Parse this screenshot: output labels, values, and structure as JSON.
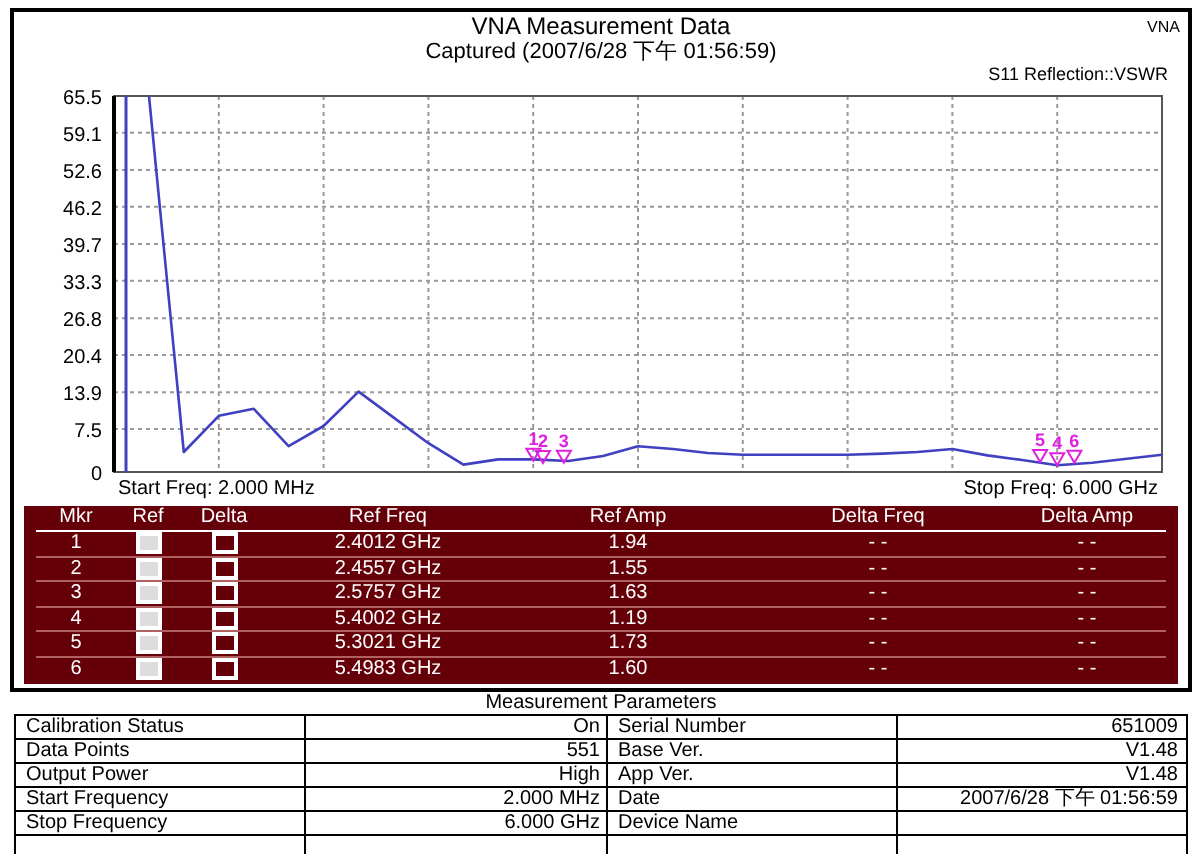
{
  "header": {
    "title": "VNA Measurement Data",
    "subtitle": "Captured  (2007/6/28 下午 01:56:59)",
    "badge": "VNA"
  },
  "chart": {
    "measurement": "S11 Reflection::VSWR",
    "start_label": "Start Freq: 2.000 MHz",
    "stop_label": "Stop Freq: 6.000 GHz",
    "chart_data": {
      "type": "line",
      "categories": [
        null,
        null,
        null,
        null,
        null,
        null,
        null,
        null,
        null,
        null,
        null,
        null,
        null,
        null,
        null,
        null,
        null,
        null,
        null,
        null,
        null,
        null,
        null,
        null,
        null,
        null,
        null,
        null,
        null,
        null,
        null
      ],
      "grid": true,
      "ylim": [
        0,
        65.5
      ],
      "yticks": [
        0,
        7.5,
        13.9,
        20.4,
        26.8,
        33.3,
        39.7,
        46.2,
        52.6,
        59.1,
        65.5
      ],
      "series": [
        {
          "color": "#4040c0",
          "values": [
            null,
            65.5,
            3.5,
            9.8,
            11,
            4.5,
            8,
            14,
            9.5,
            5,
            1.3,
            2.2,
            2.2,
            1.9,
            2.8,
            4.5,
            4,
            3.3,
            3,
            3,
            3,
            3,
            3.2,
            3.5,
            4,
            2.9,
            2.1,
            1.2,
            1.6,
            2.3,
            3
          ]
        }
      ]
    },
    "marker_labels": [
      "1",
      "2",
      "3",
      "5",
      "4",
      "6"
    ]
  },
  "markers": {
    "columns": [
      "Mkr",
      "Ref",
      "Delta",
      "Ref Freq",
      "Ref Amp",
      "Delta Freq",
      "Delta Amp"
    ],
    "rows": [
      {
        "mkr": "1",
        "ref_checked": false,
        "delta_checked": false,
        "ref_freq": "2.4012 GHz",
        "ref_amp": "1.94",
        "delta_freq": "- -",
        "delta_amp": "- -"
      },
      {
        "mkr": "2",
        "ref_checked": false,
        "delta_checked": false,
        "ref_freq": "2.4557 GHz",
        "ref_amp": "1.55",
        "delta_freq": "- -",
        "delta_amp": "- -"
      },
      {
        "mkr": "3",
        "ref_checked": false,
        "delta_checked": false,
        "ref_freq": "2.5757 GHz",
        "ref_amp": "1.63",
        "delta_freq": "- -",
        "delta_amp": "- -"
      },
      {
        "mkr": "4",
        "ref_checked": false,
        "delta_checked": false,
        "ref_freq": "5.4002 GHz",
        "ref_amp": "1.19",
        "delta_freq": "- -",
        "delta_amp": "- -"
      },
      {
        "mkr": "5",
        "ref_checked": false,
        "delta_checked": false,
        "ref_freq": "5.3021 GHz",
        "ref_amp": "1.73",
        "delta_freq": "- -",
        "delta_amp": "- -"
      },
      {
        "mkr": "6",
        "ref_checked": false,
        "delta_checked": false,
        "ref_freq": "5.4983 GHz",
        "ref_amp": "1.60",
        "delta_freq": "- -",
        "delta_amp": "- -"
      }
    ]
  },
  "parameters": {
    "title": "Measurement Parameters",
    "rows": [
      {
        "label": "Calibration Status",
        "value": "On",
        "label2": "Serial Number",
        "value2": "651009"
      },
      {
        "label": "Data Points",
        "value": "551",
        "label2": "Base Ver.",
        "value2": "V1.48"
      },
      {
        "label": "Output Power",
        "value": "High",
        "label2": "App Ver.",
        "value2": "V1.48"
      },
      {
        "label": "Start Frequency",
        "value": "2.000 MHz",
        "label2": "Date",
        "value2": "2007/6/28 下午 01:56:59"
      },
      {
        "label": "Stop Frequency",
        "value": "6.000 GHz",
        "label2": "Device Name"
      }
    ]
  }
}
